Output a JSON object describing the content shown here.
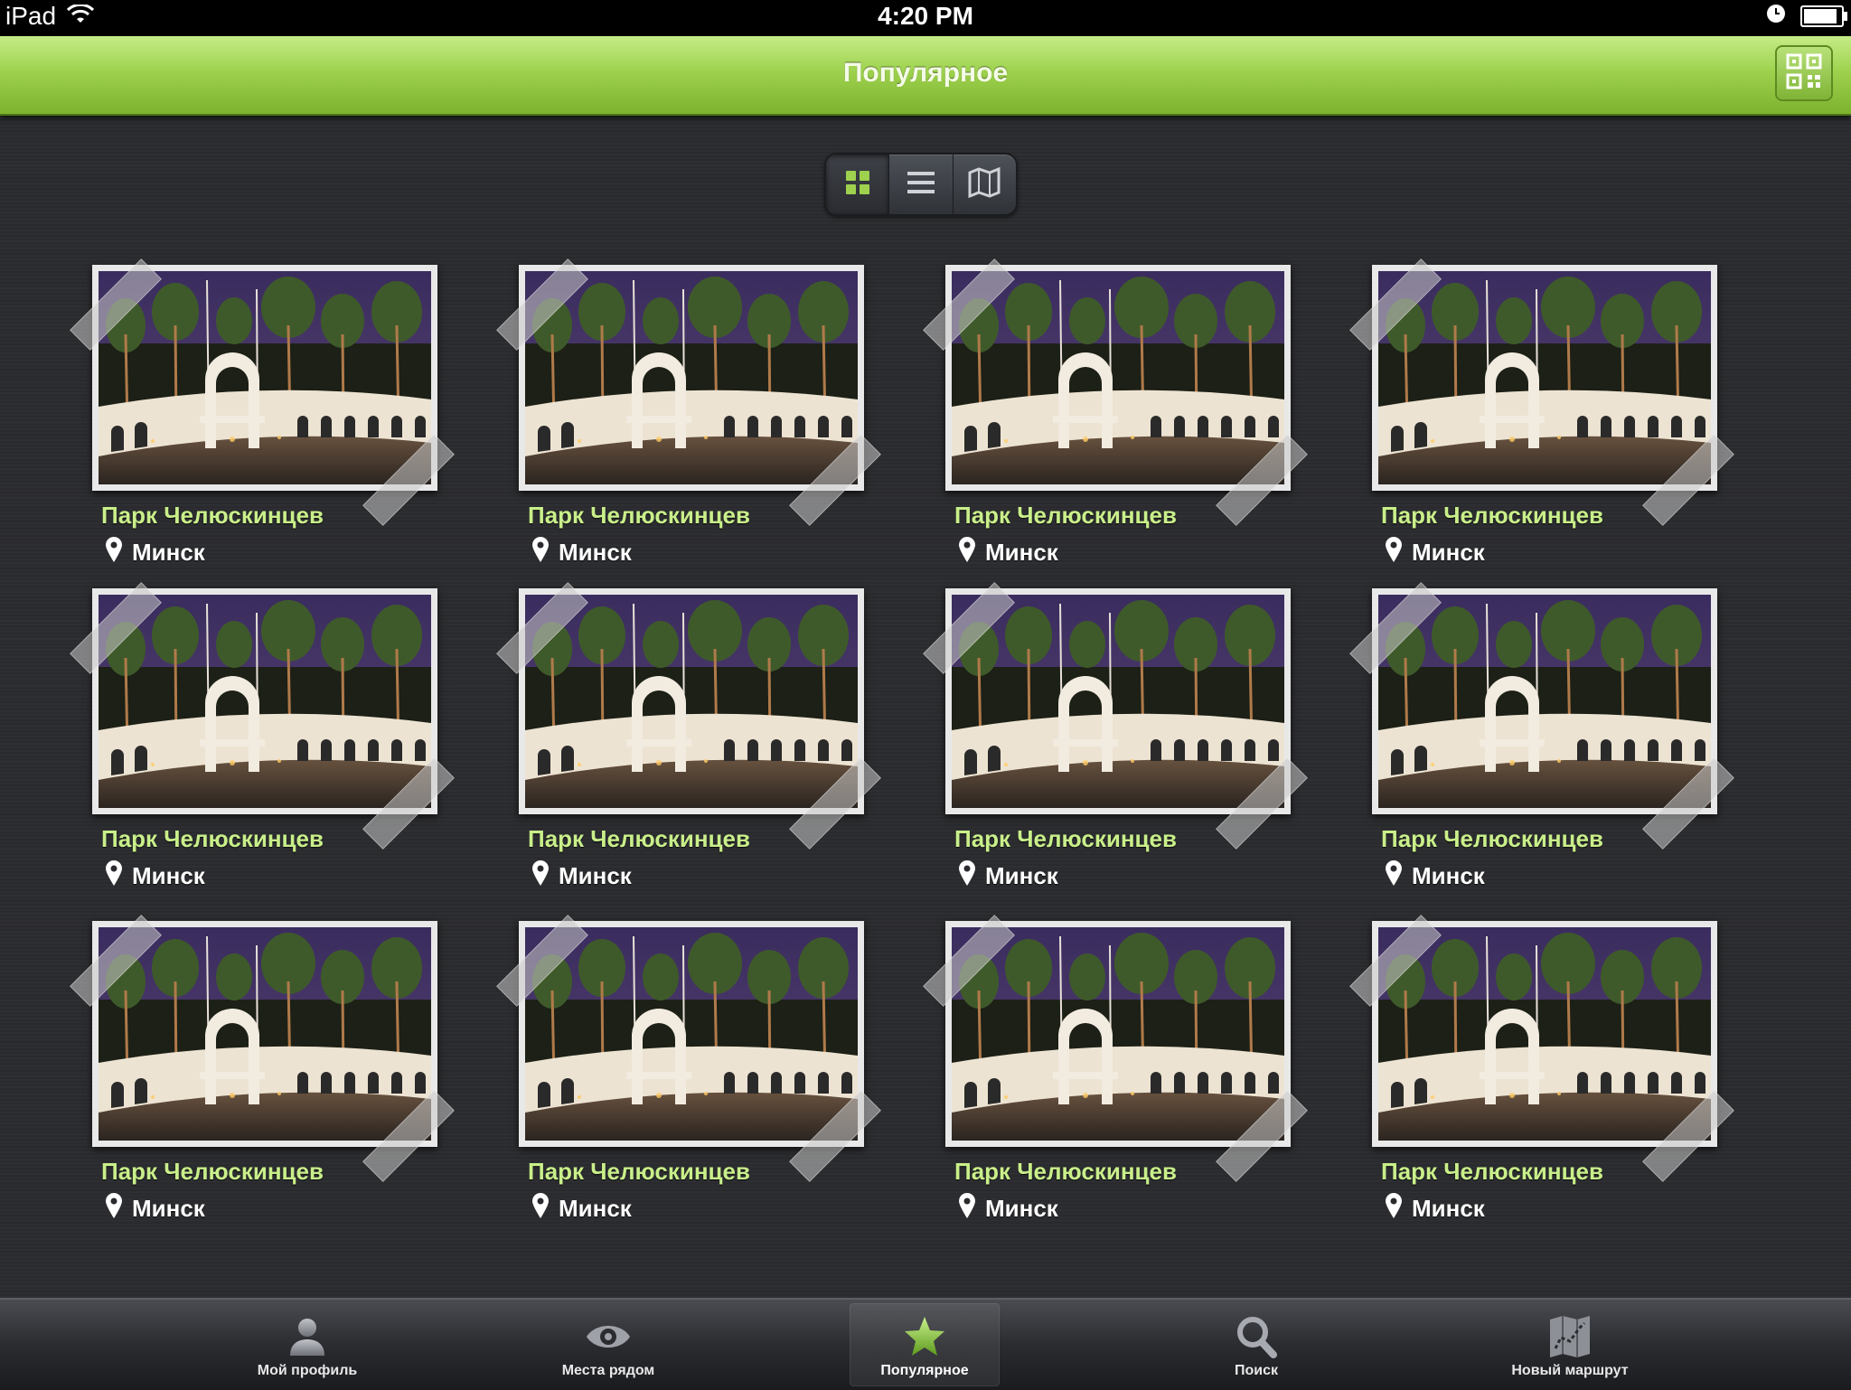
{
  "status_bar": {
    "device": "iPad",
    "time": "4:20 PM"
  },
  "navbar": {
    "title": "Популярное",
    "qr_icon": "qr-code-icon"
  },
  "view_switcher": {
    "options": [
      "grid-view-icon",
      "list-view-icon",
      "map-view-icon"
    ],
    "selected": "grid-view-icon"
  },
  "grid": {
    "items": [
      {
        "title": "Парк Челюскинцев",
        "city": "Минск"
      },
      {
        "title": "Парк Челюскинцев",
        "city": "Минск"
      },
      {
        "title": "Парк Челюскинцев",
        "city": "Минск"
      },
      {
        "title": "Парк Челюскинцев",
        "city": "Минск"
      },
      {
        "title": "Парк Челюскинцев",
        "city": "Минск"
      },
      {
        "title": "Парк Челюскинцев",
        "city": "Минск"
      },
      {
        "title": "Парк Челюскинцев",
        "city": "Минск"
      },
      {
        "title": "Парк Челюскинцев",
        "city": "Минск"
      },
      {
        "title": "Парк Челюскинцев",
        "city": "Минск"
      },
      {
        "title": "Парк Челюскинцев",
        "city": "Минск"
      },
      {
        "title": "Парк Челюскинцев",
        "city": "Минск"
      },
      {
        "title": "Парк Челюскинцев",
        "city": "Минск"
      }
    ]
  },
  "tabbar": {
    "tabs": [
      {
        "label": "Мой профиль",
        "icon": "profile-icon"
      },
      {
        "label": "Места рядом",
        "icon": "eye-icon"
      },
      {
        "label": "Популярное",
        "icon": "star-icon",
        "active": true
      },
      {
        "label": "Поиск",
        "icon": "search-icon"
      },
      {
        "label": "Новый маршрут",
        "icon": "map-route-icon"
      }
    ]
  },
  "colors": {
    "accent_green": "#9ed24e",
    "title_green": "#c9ef8a",
    "background": "#2a2b2e"
  }
}
